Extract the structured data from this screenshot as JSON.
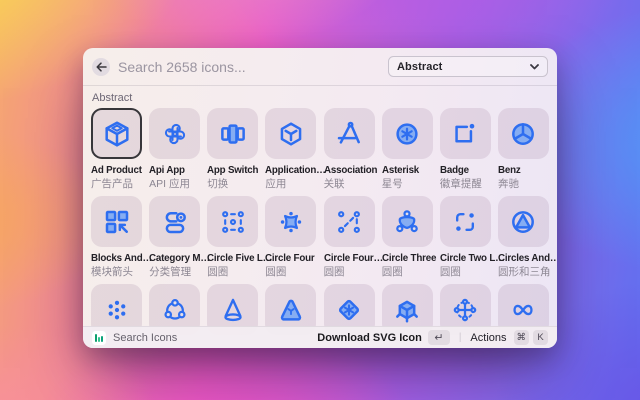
{
  "header": {
    "search_placeholder": "Search 2658 icons...",
    "category_dropdown_value": "Abstract"
  },
  "section_label": "Abstract",
  "colors": {
    "icon_stroke": "#2e6ef0",
    "icon_fill": "#86adf2",
    "selected_border": "#39383c"
  },
  "grid": {
    "rows": [
      {
        "items": [
          {
            "icon": "cube-box",
            "name": "Ad Product",
            "sub": "广告产品",
            "selected": true
          },
          {
            "icon": "api-app",
            "name": "Api App",
            "sub": "API 应用"
          },
          {
            "icon": "app-switch",
            "name": "App Switch",
            "sub": "切换"
          },
          {
            "icon": "hexagon-y",
            "name": "Application…",
            "sub": "应用"
          },
          {
            "icon": "a-frame",
            "name": "Association",
            "sub": "关联"
          },
          {
            "icon": "asterisk-circle",
            "name": "Asterisk",
            "sub": "星号"
          },
          {
            "icon": "badge-dot",
            "name": "Badge",
            "sub": "徽章提醒"
          },
          {
            "icon": "benz",
            "name": "Benz",
            "sub": "奔驰"
          }
        ]
      },
      {
        "items": [
          {
            "icon": "blocks-arrow",
            "name": "Blocks And…",
            "sub": "模块箭头"
          },
          {
            "icon": "category",
            "name": "Category M…",
            "sub": "分类管理"
          },
          {
            "icon": "circle-five",
            "name": "Circle Five L…",
            "sub": "圆圈"
          },
          {
            "icon": "clover-dots",
            "name": "Circle Four",
            "sub": "圆圈"
          },
          {
            "icon": "circle-four-line",
            "name": "Circle Four…",
            "sub": "圆圈"
          },
          {
            "icon": "circle-three",
            "name": "Circle Three",
            "sub": "圆圈"
          },
          {
            "icon": "circle-two-line",
            "name": "Circle Two L…",
            "sub": "圆圈"
          },
          {
            "icon": "circle-triangle",
            "name": "Circles And…",
            "sub": "圆形和三角"
          }
        ]
      },
      {
        "items": [
          {
            "icon": "dots-cluster"
          },
          {
            "icon": "orbit-nodes"
          },
          {
            "icon": "cone"
          },
          {
            "icon": "triangle-mark"
          },
          {
            "icon": "diamond-asterisk"
          },
          {
            "icon": "cube-legs"
          },
          {
            "icon": "cross-dots"
          },
          {
            "icon": "infinity"
          }
        ]
      }
    ]
  },
  "footer": {
    "app_label": "Search Icons",
    "primary_action": "Download SVG Icon",
    "primary_key": "↵",
    "secondary_action": "Actions",
    "secondary_keys": [
      "⌘",
      "K"
    ]
  }
}
